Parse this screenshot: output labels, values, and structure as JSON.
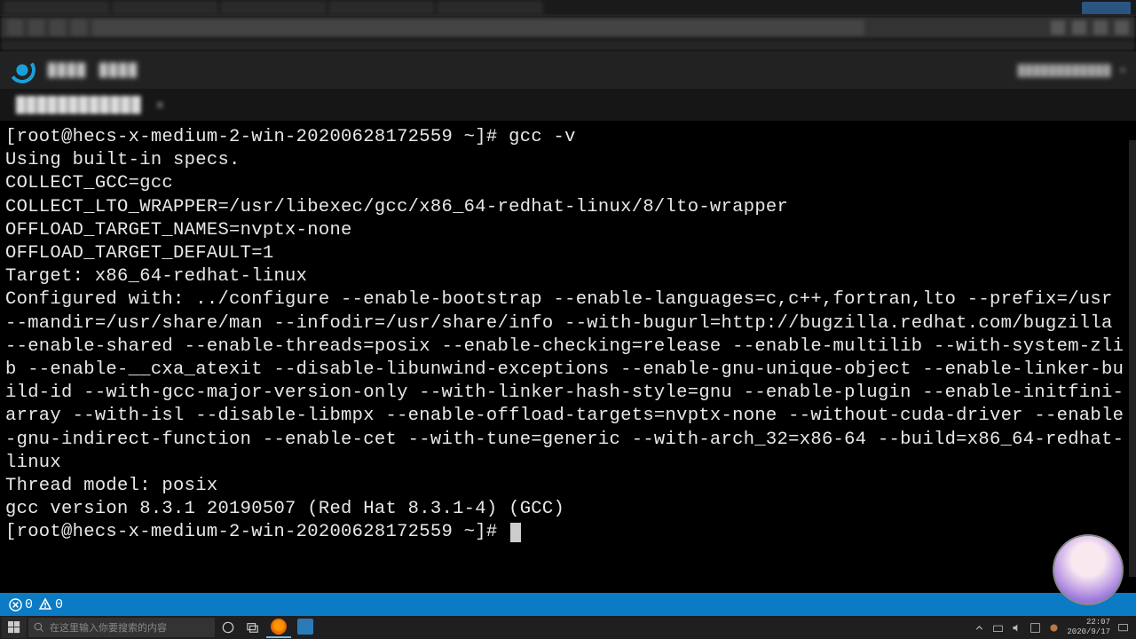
{
  "terminal": {
    "prompt": "[root@hecs-x-medium-2-win-20200628172559 ~]#",
    "command": "gcc -v",
    "lines": [
      "Using built-in specs.",
      "COLLECT_GCC=gcc",
      "COLLECT_LTO_WRAPPER=/usr/libexec/gcc/x86_64-redhat-linux/8/lto-wrapper",
      "OFFLOAD_TARGET_NAMES=nvptx-none",
      "OFFLOAD_TARGET_DEFAULT=1",
      "Target: x86_64-redhat-linux",
      "Configured with: ../configure --enable-bootstrap --enable-languages=c,c++,fortran,lto --prefix=/usr --mandir=/usr/share/man --infodir=/usr/share/info --with-bugurl=http://bugzilla.redhat.com/bugzilla --enable-shared --enable-threads=posix --enable-checking=release --enable-multilib --with-system-zlib --enable-__cxa_atexit --disable-libunwind-exceptions --enable-gnu-unique-object --enable-linker-build-id --with-gcc-major-version-only --with-linker-hash-style=gnu --enable-plugin --enable-initfini-array --with-isl --disable-libmpx --enable-offload-targets=nvptx-none --without-cuda-driver --enable-gnu-indirect-function --enable-cet --with-tune=generic --with-arch_32=x86-64 --build=x86_64-redhat-linux",
      "Thread model: posix",
      "gcc version 8.3.1 20190507 (Red Hat 8.3.1-4) (GCC)"
    ],
    "prompt2": "[root@hecs-x-medium-2-win-20200628172559 ~]#"
  },
  "status": {
    "errors": "0",
    "warnings": "0"
  },
  "taskbar": {
    "search_placeholder": "在这里输入你要搜索的内容"
  },
  "tray": {
    "time": "22:07",
    "date": "2020/9/17"
  },
  "app_header": {
    "left1": "████",
    "left2": "████",
    "right": "████████████ ▾"
  },
  "terminal_tab": {
    "label": "████████████",
    "close": "✕"
  }
}
